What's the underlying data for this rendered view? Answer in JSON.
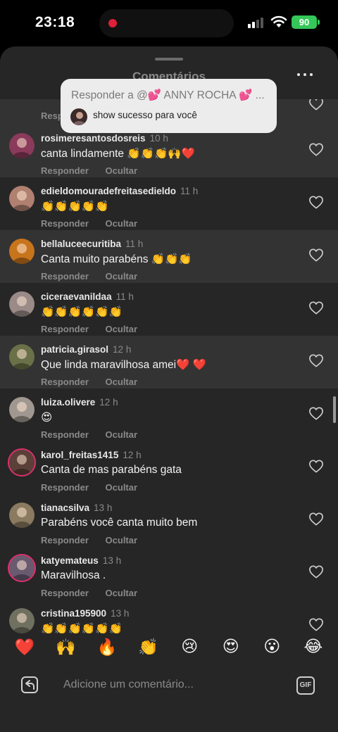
{
  "status_bar": {
    "time": "23:18",
    "battery": "90"
  },
  "sheet": {
    "title": "Comentários"
  },
  "reply_preview": {
    "title": "Responder a @💕 ANNY ROCHA 💕 ...",
    "text": "show sucesso para você"
  },
  "top_partial": {
    "reply_label": "Responder"
  },
  "comments": [
    {
      "user": "rosimeresantosdosreis",
      "time": "10 h",
      "text": "canta lindamente 👏👏👏🙌❤️",
      "reply": "Responder",
      "hide": "Ocultar",
      "avatar_color": "#8a3a5a"
    },
    {
      "user": "edieldomouradefreitasedieldo",
      "time": "11 h",
      "text": "👏👏👏👏👏",
      "reply": "Responder",
      "hide": "Ocultar",
      "avatar_color": "#b08070"
    },
    {
      "user": "bellaluceecuritiba",
      "time": "11 h",
      "text": "Canta muito parabéns 👏👏👏",
      "reply": "Responder",
      "hide": "Ocultar",
      "avatar_color": "#c8741c"
    },
    {
      "user": "ciceraevanildaa",
      "time": "11 h",
      "text": "👏👏👏👏👏👏",
      "reply": "Responder",
      "hide": "Ocultar",
      "avatar_color": "#9a8a88"
    },
    {
      "user": "patricia.girasol",
      "time": "12 h",
      "text": "Que linda maravilhosa amei❤️ ❤️",
      "reply": "Responder",
      "hide": "Ocultar",
      "avatar_color": "#6a7048"
    },
    {
      "user": "luiza.olivere",
      "time": "12 h",
      "text": "😍",
      "reply": "Responder",
      "hide": "Ocultar",
      "avatar_color": "#a09890"
    },
    {
      "user": "karol_freitas1415",
      "time": "12 h",
      "text": "Canta de mas parabéns gata",
      "reply": "Responder",
      "hide": "Ocultar",
      "avatar_color": "#5a4038"
    },
    {
      "user": "tianacsilva",
      "time": "13 h",
      "text": "Parabéns você canta muito bem",
      "reply": "Responder",
      "hide": "Ocultar",
      "avatar_color": "#8a7a60"
    },
    {
      "user": "katyemateus",
      "time": "13 h",
      "text": "Maravilhosa .",
      "reply": "Responder",
      "hide": "Ocultar",
      "avatar_color": "#6a5a70"
    },
    {
      "user": "cristina195900",
      "time": "13 h",
      "text": "👏👏👏👏👏👏",
      "reply": "",
      "hide": "",
      "avatar_color": "#707060"
    }
  ],
  "emoji_reactions": [
    "❤️",
    "🙌",
    "🔥",
    "👏",
    "😢",
    "😍",
    "😮",
    "😂"
  ],
  "input": {
    "placeholder": "Adicione um comentário..."
  },
  "gif_label": "GIF"
}
